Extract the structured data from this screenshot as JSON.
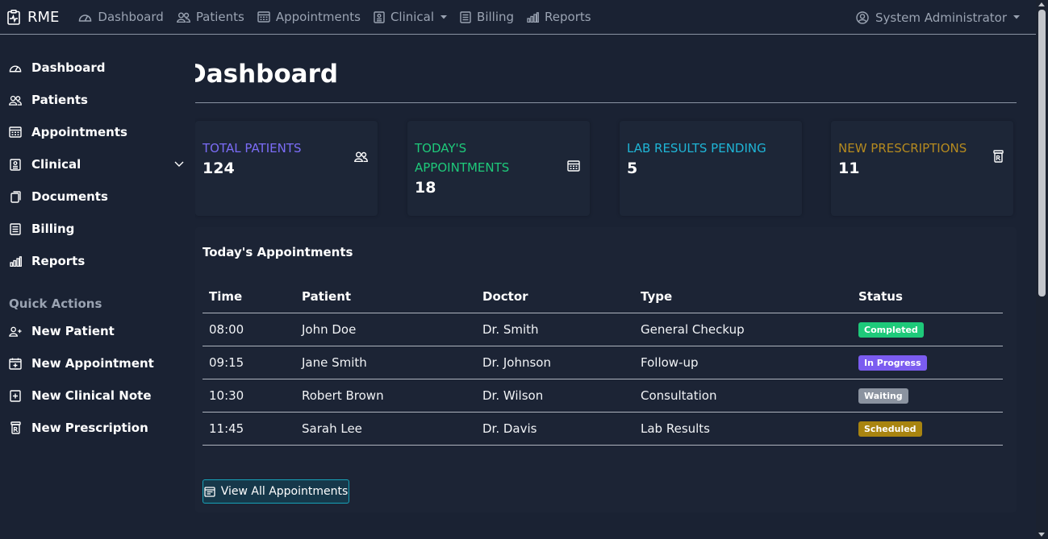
{
  "navbar": {
    "brand": "RME",
    "items": [
      {
        "label": "Dashboard",
        "icon": "dashboard-icon"
      },
      {
        "label": "Patients",
        "icon": "patients-icon"
      },
      {
        "label": "Appointments",
        "icon": "calendar-icon"
      },
      {
        "label": "Clinical",
        "icon": "clinical-icon"
      },
      {
        "label": "Billing",
        "icon": "billing-icon"
      },
      {
        "label": "Reports",
        "icon": "reports-icon"
      }
    ],
    "user": "System Administrator"
  },
  "sidebar": {
    "items": [
      {
        "label": "Dashboard",
        "icon": "dashboard-icon"
      },
      {
        "label": "Patients",
        "icon": "patients-icon"
      },
      {
        "label": "Appointments",
        "icon": "calendar-icon"
      },
      {
        "label": "Clinical",
        "icon": "clinical-icon"
      },
      {
        "label": "Documents",
        "icon": "documents-icon"
      },
      {
        "label": "Billing",
        "icon": "billing-icon"
      },
      {
        "label": "Reports",
        "icon": "reports-icon"
      }
    ],
    "quick_actions_heading": "Quick Actions",
    "quick_actions": [
      {
        "label": "New Patient",
        "icon": "add-person-icon"
      },
      {
        "label": "New Appointment",
        "icon": "calendar-plus-icon"
      },
      {
        "label": "New Clinical Note",
        "icon": "note-plus-icon"
      },
      {
        "label": "New Prescription",
        "icon": "prescription-icon"
      }
    ]
  },
  "page": {
    "title": "Dashboard"
  },
  "stats": [
    {
      "label": "TOTAL PATIENTS",
      "value": "124",
      "color": "#7b6cf6",
      "icon": "patients-icon"
    },
    {
      "label": "TODAY'S APPOINTMENTS",
      "value": "18",
      "color": "#1ec97a",
      "icon": "calendar-icon"
    },
    {
      "label": "LAB RESULTS PENDING",
      "value": "5",
      "color": "#1fb5d6",
      "icon": ""
    },
    {
      "label": "NEW PRESCRIPTIONS",
      "value": "11",
      "color": "#b58a1f",
      "icon": "prescription-icon"
    }
  ],
  "appointments": {
    "title": "Today's Appointments",
    "columns": [
      "Time",
      "Patient",
      "Doctor",
      "Type",
      "Status"
    ],
    "rows": [
      {
        "time": "08:00",
        "patient": "John Doe",
        "doctor": "Dr. Smith",
        "type": "General Checkup",
        "status": "Completed",
        "status_color": "#1ec97a"
      },
      {
        "time": "09:15",
        "patient": "Jane Smith",
        "doctor": "Dr. Johnson",
        "type": "Follow-up",
        "status": "In Progress",
        "status_color": "#7b5cf0"
      },
      {
        "time": "10:30",
        "patient": "Robert Brown",
        "doctor": "Dr. Wilson",
        "type": "Consultation",
        "status": "Waiting",
        "status_color": "#8b93a0"
      },
      {
        "time": "11:45",
        "patient": "Sarah Lee",
        "doctor": "Dr. Davis",
        "type": "Lab Results",
        "status": "Scheduled",
        "status_color": "#a88410"
      }
    ],
    "view_all_label": "View All Appointments"
  }
}
